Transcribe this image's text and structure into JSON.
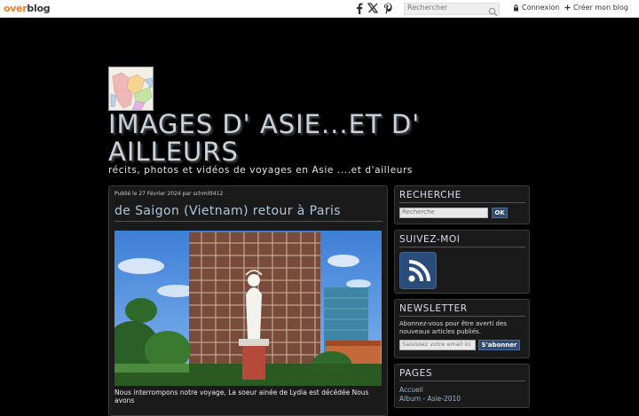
{
  "topbar": {
    "logo_part1": "over",
    "logo_part2": "blog",
    "search_placeholder": "Rechercher",
    "login_label": "Connexion",
    "create_label": "Créer mon blog"
  },
  "header": {
    "title": "IMAGES D' ASIE...ET D' AILLEURS",
    "subtitle": "récits, photos et vidéos de voyages en Asie ....et d'ailleurs"
  },
  "post": {
    "meta": "Publié le 27 Février 2024 par schmitt412",
    "title": "de Saigon (Vietnam) retour à Paris",
    "excerpt": "Nous interrompons notre voyage, La soeur ainée de Lydia est décédée Nous avons"
  },
  "sidebar": {
    "search": {
      "title": "RECHERCHE",
      "placeholder": "Recherche",
      "button": "OK"
    },
    "follow": {
      "title": "SUIVEZ-MOI"
    },
    "newsletter": {
      "title": "NEWSLETTER",
      "text": "Abonnez-vous pour être averti des nouveaux articles publiés.",
      "placeholder": "Saisissez votre email ici",
      "button": "S'abonner"
    },
    "pages": {
      "title": "PAGES",
      "items": [
        "Accueil",
        "Album - Asie-2010"
      ]
    }
  },
  "colors": {
    "brand_orange": "#f57d20",
    "title_blue": "#aec7df",
    "button_blue": "#2f4a73",
    "background": "#000000"
  }
}
